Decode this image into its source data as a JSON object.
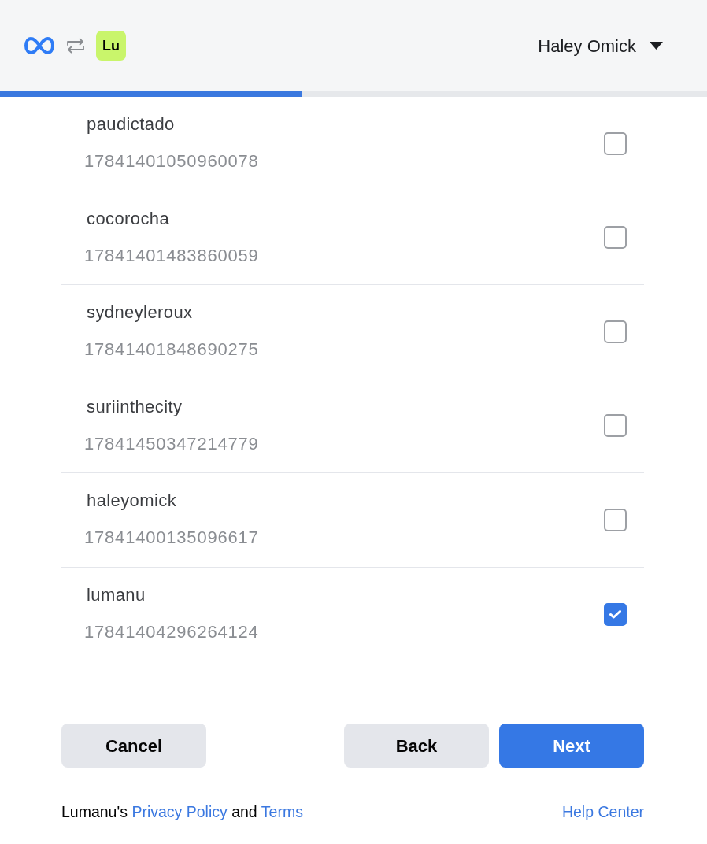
{
  "header": {
    "app_logo": "Lu",
    "user_menu": {
      "label": "Haley Omick"
    }
  },
  "progress": {
    "level": 0.427
  },
  "accounts": [
    {
      "name": "paudictado",
      "id": "17841401050960078",
      "checked": false
    },
    {
      "name": "cocorocha",
      "id": "17841401483860059",
      "checked": false
    },
    {
      "name": "sydneyleroux",
      "id": "17841401848690275",
      "checked": false
    },
    {
      "name": "suriinthecity",
      "id": "17841450347214779",
      "checked": false
    },
    {
      "name": "haleyomick",
      "id": "17841400135096617",
      "checked": false
    },
    {
      "name": "lumanu",
      "id": "17841404296264124",
      "checked": true
    }
  ],
  "actions_start": [
    {
      "label": "Cancel",
      "primary": false
    }
  ],
  "actions_end": [
    {
      "label": "Back",
      "primary": false
    },
    {
      "label": "Next",
      "primary": true
    }
  ],
  "footer": {
    "legal": [
      {
        "kind": "text",
        "text": "Lumanu's"
      },
      {
        "kind": "link",
        "text": "Privacy Policy"
      },
      {
        "kind": "text",
        "text": "and"
      },
      {
        "kind": "link",
        "text": "Terms"
      }
    ],
    "help_link": "Help Center"
  }
}
